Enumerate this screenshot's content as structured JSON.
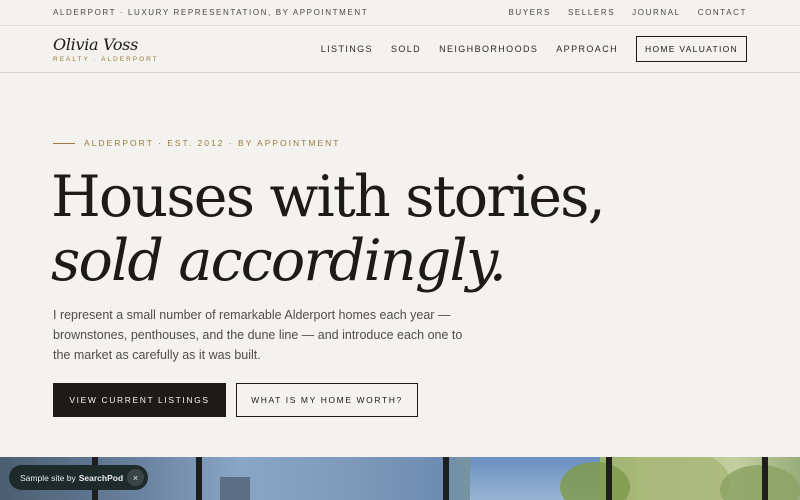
{
  "topbar": {
    "tagline": "ALDERPORT · LUXURY REPRESENTATION, BY APPOINTMENT",
    "links": [
      "BUYERS",
      "SELLERS",
      "JOURNAL",
      "CONTACT"
    ]
  },
  "header": {
    "brand_name": "Olivia Voss",
    "brand_sub": "REALTY · ALDERPORT",
    "nav": [
      "LISTINGS",
      "SOLD",
      "NEIGHBORHOODS",
      "APPROACH"
    ],
    "cta": "HOME VALUATION"
  },
  "hero": {
    "eyebrow": "ALDERPORT · EST. 2012 · BY APPOINTMENT",
    "headline_line1": "Houses with stories,",
    "headline_line2": "sold accordingly.",
    "intro": "I represent a small number of remarkable Alderport homes each year — brownstones, penthouses, and the dune line — and introduce each one to the market as carefully as it was built.",
    "primary_button": "VIEW CURRENT LISTINGS",
    "secondary_button": "WHAT IS MY HOME WORTH?"
  },
  "badge": {
    "prefix": "Sample site by",
    "brand": "SearchPod",
    "close": "×"
  }
}
